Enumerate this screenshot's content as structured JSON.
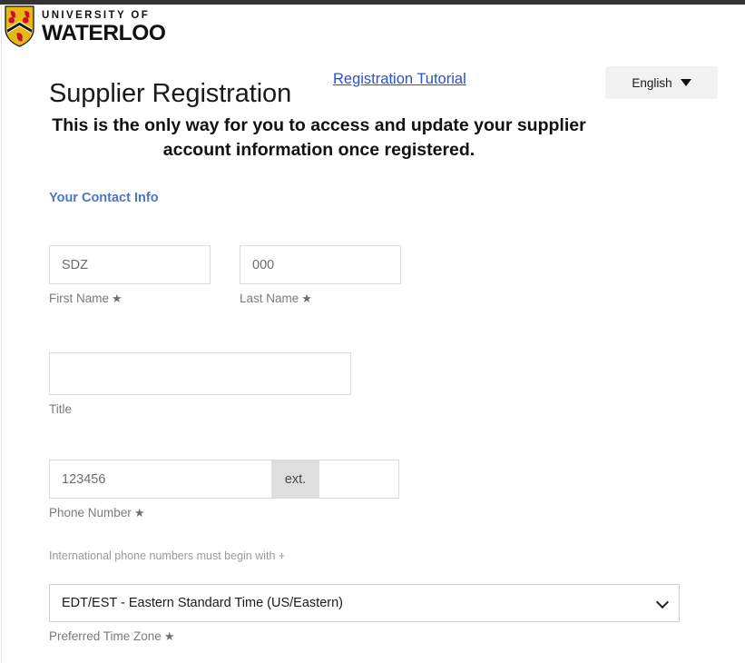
{
  "brand": {
    "line1": "UNIVERSITY OF",
    "line2": "WATERLOO",
    "shield_gold": "#e8b810",
    "shield_red": "#c8102e",
    "shield_dark": "#1a1a1a"
  },
  "header": {
    "title": "Supplier Registration",
    "tutorial_link": "Registration Tutorial",
    "language": "English",
    "link_color": "#2a4fd6"
  },
  "banner": {
    "text": "This is the only way for you to access and update your supplier account information once registered."
  },
  "section": {
    "heading": "Your Contact Info",
    "heading_color": "#4a78c4"
  },
  "form": {
    "required_marker": "★",
    "first_name": {
      "label": "First Name",
      "value": "SDZ",
      "placeholder": "",
      "required": true
    },
    "last_name": {
      "label": "Last Name",
      "value": "000",
      "placeholder": "",
      "required": true
    },
    "title": {
      "label": "Title",
      "value": "",
      "placeholder": "",
      "required": false
    },
    "phone": {
      "label": "Phone Number",
      "value": "123456",
      "placeholder": "",
      "ext_addon": "ext.",
      "ext_value": "",
      "required": true,
      "hint": "International phone numbers must begin with +"
    },
    "timezone": {
      "label": "Preferred Time Zone",
      "value": "EDT/EST - Eastern Standard Time (US/Eastern)",
      "required": true
    }
  }
}
